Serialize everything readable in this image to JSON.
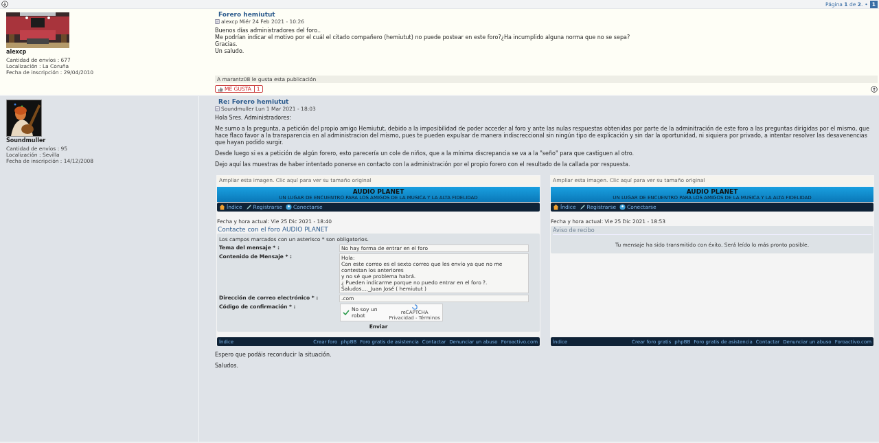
{
  "top_bar": {
    "pagination": {
      "label": "Página **1** de **2**.",
      "separator": "•",
      "pages": [
        {
          "label": "1",
          "selected": true
        }
      ]
    }
  },
  "posts": [
    {
      "author": {
        "name": "alexcp",
        "stats": [
          "Cantidad de envíos : 677",
          "Localización : La Coruña",
          "Fecha de inscripción : 29/04/2010"
        ]
      },
      "title": "Forero hemiutut",
      "meta": "alexcp Miér 24 Feb 2021 - 10:26",
      "body": [
        {
          "kind": "text",
          "lines": [
            "Buenos días administradores del foro..",
            "Me podrían indicar el motivo por el cuál el citado compañero (hemiutut) no puede postear en este foro?¿Ha incumplido alguna norma que no se sepa?",
            "Gracias.",
            "Un saludo."
          ]
        }
      ],
      "likes": {
        "text": "A marantz08 le gusta esta publicación",
        "button_label": "ME GUSTA",
        "count": "1"
      }
    },
    {
      "author": {
        "name": "Soundmuller",
        "stats": [
          "Cantidad de envíos : 95",
          "Localización : Sevilla",
          "Fecha de inscripción : 14/12/2008"
        ]
      },
      "title": "Re: Forero hemiutut",
      "meta": "Soundmuller Lun 1 Mar 2021 - 18:03",
      "body": [
        {
          "kind": "text",
          "lines": [
            "Hola Sres. Administradores:"
          ]
        },
        {
          "kind": "text",
          "lines": [
            "Me sumo a la pregunta, a petición del propio amigo Hemiutut, debido a la imposibilidad de poder acceder al foro y ante las nulas respuestas obtenidas por parte de la adminitración de este foro a las preguntas dirigidas por el mismo, que hace flaco favor a la transparencia en al administracion del mismo, pues te pueden expulsar de manera indiscreccional sin ningún tipo de explicación y sin dar la oportunidad, ni siquiera por privado, a intentar resolver las desavenencias que hayan podido surgir."
          ]
        },
        {
          "kind": "text",
          "lines": [
            "Desde luego si es a petición de algún forero, esto parecería un cole de niños, que a la mínima discrepancia se va a la \"seño\" para que castiguen al otro."
          ]
        },
        {
          "kind": "text",
          "lines": [
            "Dejo aquí las muestras de haber intentado ponerse en contacto con la administración por el propio forero con el resultado de la callada por respuesta."
          ]
        },
        {
          "kind": "screenshot",
          "caption": "Ampliar esta imagen. Clic aquí para ver su tamaño original",
          "site_title": "AUDIO PLANET",
          "site_subtitle": "UN LUGAR DE ENCUENTRO PARA LOS AMIGOS DE LA MUSICA Y LA ALTA FIDELIDAD",
          "nav": [
            "Índice",
            "Registrarse",
            "Conectarse"
          ],
          "datetime": "Fecha y hora actual: Vie 25 Dic 2021 - 18:40",
          "content": {
            "kind": "contact_form",
            "title": "Contacte con el foro AUDIO PLANET",
            "note": "Los campos marcados con un asterisco * son obligatorios.",
            "fields": [
              {
                "kind": "input",
                "label": "Tema del mensaje * :",
                "value": "No hay forma de entrar en el foro"
              },
              {
                "kind": "textarea",
                "label": "Contenido de Mensaje * :",
                "lines": [
                  "Hola:",
                  "Con este correo es el sexto correo que les envío ya que no me contestan los anteriores",
                  "y no sé que problema habrá.",
                  "¿ Pueden indicarme porque no puedo entrar en el foro ?.",
                  "Saludos...._Juan José ( hemiutut )"
                ]
              },
              {
                "kind": "input",
                "label": "Dirección de correo electrónico * :",
                "value": ".com"
              },
              {
                "kind": "captcha",
                "label": "Código de confirmación * :",
                "check_label": "No soy un robot",
                "brand": "reCAPTCHA",
                "terms": "Privacidad - Términos"
              }
            ],
            "submit": "Enviar"
          },
          "footer_left": "Índice",
          "footer_links": [
            "Crear foro",
            "phpBB",
            "Foro gratis de asistencia",
            "Contactar",
            "Denunciar un abuso",
            "Foroactivo.com"
          ]
        },
        {
          "kind": "screenshot",
          "caption": "Ampliar esta imagen. Clic aquí para ver su tamaño original",
          "site_title": "AUDIO PLANET",
          "site_subtitle": "UN LUGAR DE ENCUENTRO PARA LOS AMIGOS DE LA MUSICA Y LA ALTA FIDELIDAD",
          "nav": [
            "Índice",
            "Registrarse",
            "Conectarse"
          ],
          "datetime": "Fecha y hora actual: Vie 25 Dic 2021 - 18:53",
          "content": {
            "kind": "notice",
            "heading": "Aviso de recibo",
            "message": "Tu mensaje ha sido transmitido con éxito. Será leído lo más pronto posible."
          },
          "footer_left": "Índice",
          "footer_links": [
            "Crear foro gratis",
            "phpBB",
            "Foro gratis de asistencia",
            "Contactar",
            "Denunciar un abuso",
            "Foroactivo.com"
          ]
        },
        {
          "kind": "text",
          "lines": [
            "Espero que podáis reconducir la situación."
          ]
        },
        {
          "kind": "text",
          "lines": [
            "Saludos."
          ]
        }
      ]
    }
  ]
}
